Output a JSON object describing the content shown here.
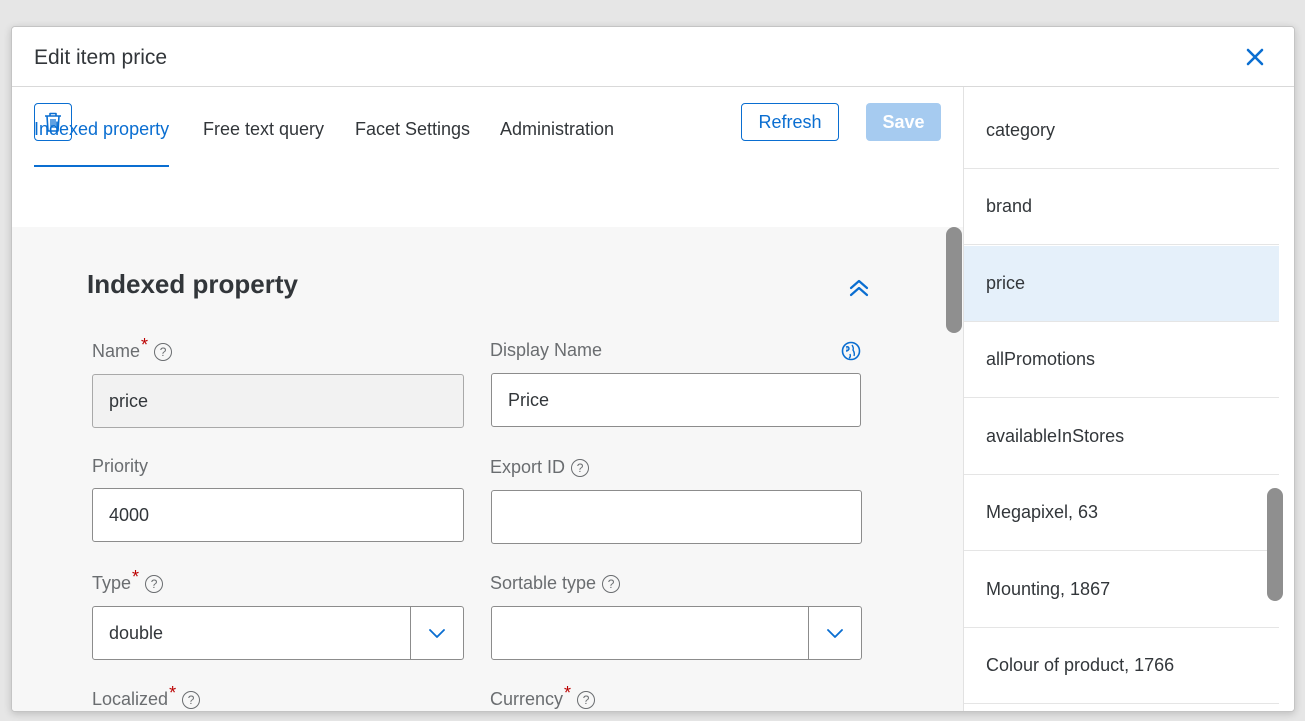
{
  "dialog": {
    "title": "Edit item price",
    "close_icon": "close-icon"
  },
  "toolbar": {
    "refresh_label": "Refresh",
    "save_label": "Save"
  },
  "tabs": [
    {
      "label": "Indexed property"
    },
    {
      "label": "Free text query"
    },
    {
      "label": "Facet Settings"
    },
    {
      "label": "Administration"
    }
  ],
  "section": {
    "title": "Indexed property"
  },
  "fields": {
    "name": {
      "label": "Name",
      "value": "price"
    },
    "display_name": {
      "label": "Display Name",
      "value": "Price"
    },
    "priority": {
      "label": "Priority",
      "value": "4000"
    },
    "export_id": {
      "label": "Export ID",
      "value": ""
    },
    "type": {
      "label": "Type",
      "value": "double"
    },
    "sortable_type": {
      "label": "Sortable type",
      "value": ""
    },
    "localized": {
      "label": "Localized"
    },
    "currency": {
      "label": "Currency"
    }
  },
  "help_glyph": "?",
  "required_glyph": "*",
  "side_list": [
    {
      "label": "category"
    },
    {
      "label": "brand"
    },
    {
      "label": "price"
    },
    {
      "label": "allPromotions"
    },
    {
      "label": "availableInStores"
    },
    {
      "label": "Megapixel, 63"
    },
    {
      "label": "Mounting, 1867"
    },
    {
      "label": "Colour of product, 1766"
    }
  ],
  "colors": {
    "accent": "#0a6ed1",
    "selected_bg": "#e5f0fa",
    "required": "#bb0000",
    "save_disabled": "#a6cbf0"
  }
}
